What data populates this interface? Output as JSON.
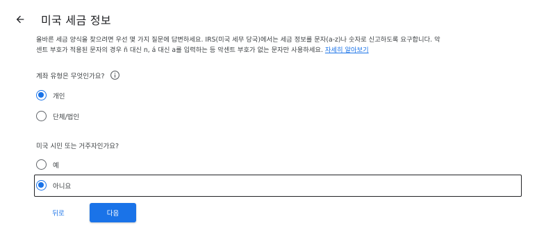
{
  "header": {
    "back_icon": "arrow-back-icon",
    "title": "미국 세금 정보"
  },
  "description": {
    "line1": "올바른 세금 양식을 찾으려면 우선 몇 가지 질문에 답변하세요. IRS(미국 세무 당국)에서는 세금 정보를 문자(a-z)나 숫자로 신고하도록 요구합니다. 악",
    "line2": "센트 부호가 적용된 문자의 경우 ñ 대신 n, á 대신 a를 입력하는 등 악센트 부호가 없는 문자만 사용하세요.",
    "link": "자세히 알아보기"
  },
  "account_type": {
    "question": "계좌 유형은 무엇인가요?",
    "info_icon": "info-icon",
    "options": [
      {
        "label": "개인",
        "selected": true
      },
      {
        "label": "단체/법인",
        "selected": false
      }
    ]
  },
  "us_person": {
    "question": "미국 시민 또는 거주자인가요?",
    "options": [
      {
        "label": "예",
        "selected": false
      },
      {
        "label": "아니요",
        "selected": true
      }
    ]
  },
  "actions": {
    "back_label": "뒤로",
    "next_label": "다음"
  },
  "colors": {
    "accent": "#1a73e8",
    "text": "#3c4043",
    "title": "#202124"
  }
}
